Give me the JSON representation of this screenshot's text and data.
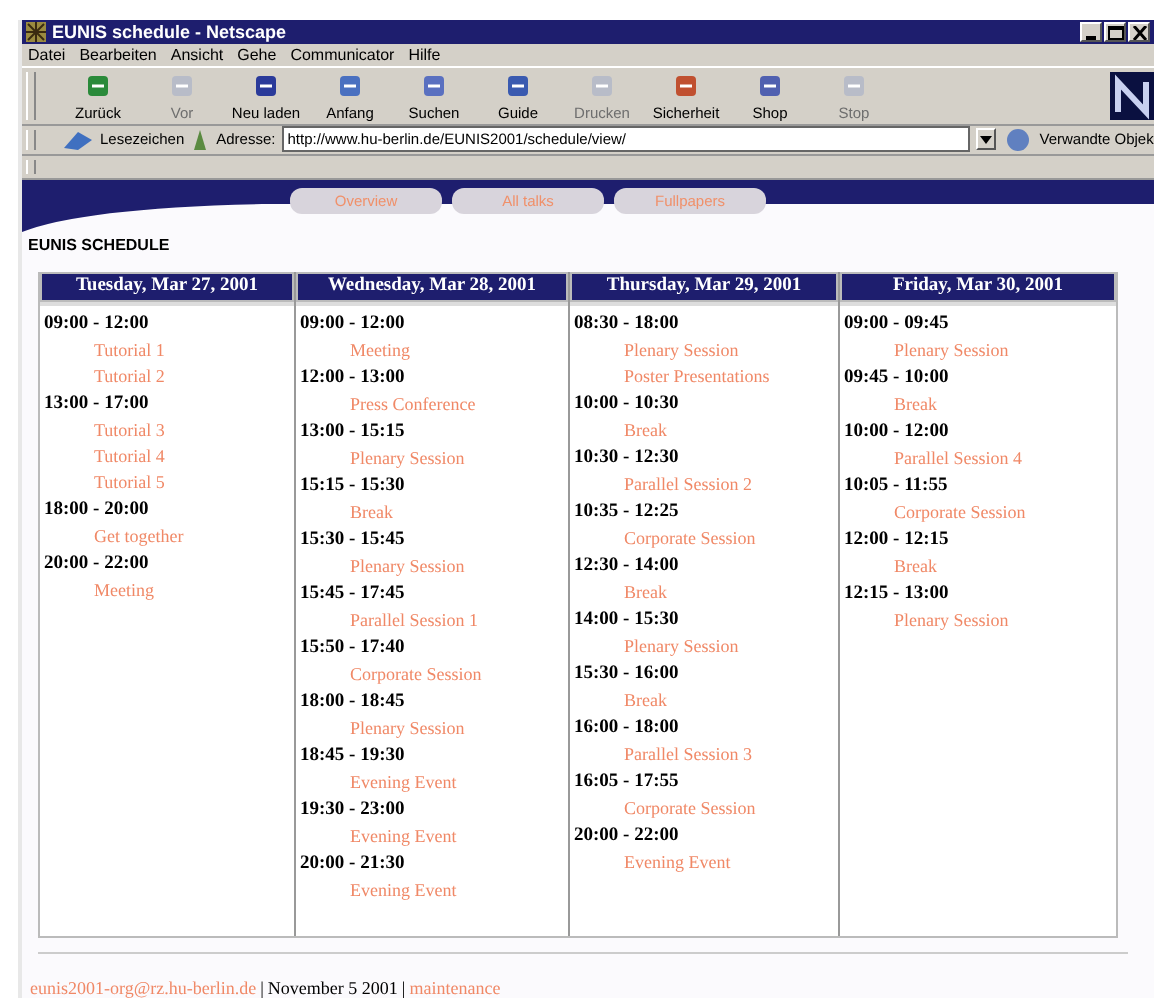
{
  "window": {
    "title": "EUNIS schedule - Netscape"
  },
  "menu": [
    "Datei",
    "Bearbeiten",
    "Ansicht",
    "Gehe",
    "Communicator",
    "Hilfe"
  ],
  "toolbar": [
    {
      "label": "Zurück",
      "disabled": false
    },
    {
      "label": "Vor",
      "disabled": true
    },
    {
      "label": "Neu laden",
      "disabled": false
    },
    {
      "label": "Anfang",
      "disabled": false
    },
    {
      "label": "Suchen",
      "disabled": false
    },
    {
      "label": "Guide",
      "disabled": false
    },
    {
      "label": "Drucken",
      "disabled": true
    },
    {
      "label": "Sicherheit",
      "disabled": false
    },
    {
      "label": "Shop",
      "disabled": false
    },
    {
      "label": "Stop",
      "disabled": true
    }
  ],
  "location_bar": {
    "bookmarks": "Lesezeichen",
    "address_label": "Adresse:",
    "url": "http://www.hu-berlin.de/EUNIS2001/schedule/view/",
    "related": "Verwandte Objek"
  },
  "nav_tabs": [
    "Overview",
    "All talks",
    "Fullpapers"
  ],
  "heading": "EUNIS SCHEDULE",
  "days": [
    {
      "title": "Tuesday, Mar 27, 2001",
      "slots": [
        {
          "time": "09:00 - 12:00",
          "events": [
            "Tutorial 1",
            "Tutorial 2"
          ]
        },
        {
          "time": "13:00 - 17:00",
          "events": [
            "Tutorial 3",
            "Tutorial 4",
            "Tutorial 5"
          ]
        },
        {
          "time": "18:00 - 20:00",
          "events": [
            "Get together"
          ]
        },
        {
          "time": "20:00 - 22:00",
          "events": [
            "Meeting"
          ]
        }
      ]
    },
    {
      "title": "Wednesday, Mar 28, 2001",
      "slots": [
        {
          "time": "09:00 - 12:00",
          "events": [
            "Meeting"
          ]
        },
        {
          "time": "12:00 - 13:00",
          "events": [
            "Press Conference"
          ]
        },
        {
          "time": "13:00 - 15:15",
          "events": [
            "Plenary Session"
          ]
        },
        {
          "time": "15:15 - 15:30",
          "events": [
            "Break"
          ]
        },
        {
          "time": "15:30 - 15:45",
          "events": [
            "Plenary Session"
          ]
        },
        {
          "time": "15:45 - 17:45",
          "events": [
            "Parallel Session 1"
          ]
        },
        {
          "time": "15:50 - 17:40",
          "events": [
            "Corporate Session"
          ]
        },
        {
          "time": "18:00 - 18:45",
          "events": [
            "Plenary Session"
          ]
        },
        {
          "time": "18:45 - 19:30",
          "events": [
            "Evening Event"
          ]
        },
        {
          "time": "19:30 - 23:00",
          "events": [
            "Evening Event"
          ]
        },
        {
          "time": "20:00 - 21:30",
          "events": [
            "Evening Event"
          ]
        }
      ]
    },
    {
      "title": "Thursday, Mar 29, 2001",
      "slots": [
        {
          "time": "08:30 - 18:00",
          "events": [
            "Plenary Session",
            "Poster Presentations"
          ]
        },
        {
          "time": "10:00 - 10:30",
          "events": [
            "Break"
          ]
        },
        {
          "time": "10:30 - 12:30",
          "events": [
            "Parallel Session 2"
          ]
        },
        {
          "time": "10:35 - 12:25",
          "events": [
            "Corporate Session"
          ]
        },
        {
          "time": "12:30 - 14:00",
          "events": [
            "Break"
          ]
        },
        {
          "time": "14:00 - 15:30",
          "events": [
            "Plenary Session"
          ]
        },
        {
          "time": "15:30 - 16:00",
          "events": [
            "Break"
          ]
        },
        {
          "time": "16:00 - 18:00",
          "events": [
            "Parallel Session 3"
          ]
        },
        {
          "time": "16:05 - 17:55",
          "events": [
            "Corporate Session"
          ]
        },
        {
          "time": "20:00 - 22:00",
          "events": [
            "Evening Event"
          ]
        }
      ]
    },
    {
      "title": "Friday, Mar 30, 2001",
      "slots": [
        {
          "time": "09:00 - 09:45",
          "events": [
            "Plenary Session"
          ]
        },
        {
          "time": "09:45 - 10:00",
          "events": [
            "Break"
          ]
        },
        {
          "time": "10:00 - 12:00",
          "events": [
            "Parallel Session 4"
          ]
        },
        {
          "time": "10:05 - 11:55",
          "events": [
            "Corporate Session"
          ]
        },
        {
          "time": "12:00 - 12:15",
          "events": [
            "Break"
          ]
        },
        {
          "time": "12:15 - 13:00",
          "events": [
            "Plenary Session"
          ]
        }
      ]
    }
  ],
  "footer": {
    "email": "eunis2001-org@rz.hu-berlin.de",
    "separator_1": "|",
    "date": "November 5 2001",
    "separator_2": "|",
    "link": "maintenance"
  }
}
